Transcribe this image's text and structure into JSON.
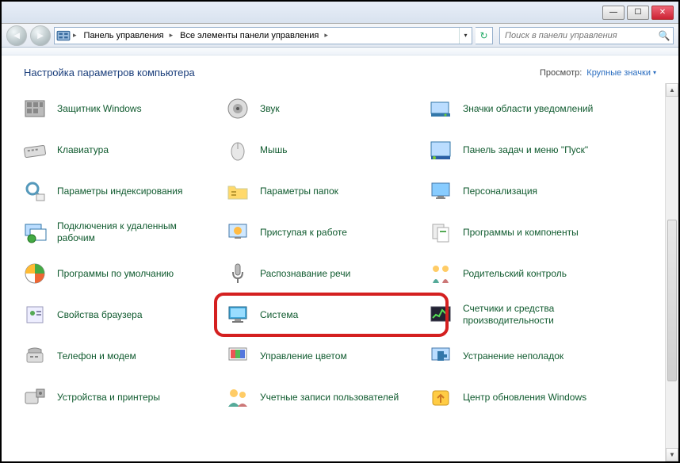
{
  "titlebar": {
    "min": "—",
    "max": "☐",
    "close": "✕"
  },
  "breadcrumb": {
    "seg1": "Панель управления",
    "seg2": "Все элементы панели управления"
  },
  "search": {
    "placeholder": "Поиск в панели управления"
  },
  "header": {
    "title": "Настройка параметров компьютера",
    "view_label": "Просмотр:",
    "view_value": "Крупные значки"
  },
  "items": [
    {
      "label": "Защитник Windows",
      "icon": "defender"
    },
    {
      "label": "Звук",
      "icon": "sound"
    },
    {
      "label": "Значки области уведомлений",
      "icon": "notification-icons"
    },
    {
      "label": "Клавиатура",
      "icon": "keyboard"
    },
    {
      "label": "Мышь",
      "icon": "mouse"
    },
    {
      "label": "Панель задач и меню \"Пуск\"",
      "icon": "taskbar"
    },
    {
      "label": "Параметры индексирования",
      "icon": "indexing"
    },
    {
      "label": "Параметры папок",
      "icon": "folder-options"
    },
    {
      "label": "Персонализация",
      "icon": "personalization"
    },
    {
      "label": "Подключения к удаленным рабочим",
      "icon": "remote"
    },
    {
      "label": "Приступая к работе",
      "icon": "getting-started"
    },
    {
      "label": "Программы и компоненты",
      "icon": "programs"
    },
    {
      "label": "Программы по умолчанию",
      "icon": "default-programs"
    },
    {
      "label": "Распознавание речи",
      "icon": "speech"
    },
    {
      "label": "Родительский контроль",
      "icon": "parental"
    },
    {
      "label": "Свойства браузера",
      "icon": "internet-options"
    },
    {
      "label": "Система",
      "icon": "system",
      "highlighted": true
    },
    {
      "label": "Счетчики и средства производительности",
      "icon": "performance"
    },
    {
      "label": "Телефон и модем",
      "icon": "phone"
    },
    {
      "label": "Управление цветом",
      "icon": "color"
    },
    {
      "label": "Устранение неполадок",
      "icon": "troubleshoot"
    },
    {
      "label": "Устройства и принтеры",
      "icon": "devices"
    },
    {
      "label": "Учетные записи пользователей",
      "icon": "users"
    },
    {
      "label": "Центр обновления Windows",
      "icon": "update"
    }
  ]
}
